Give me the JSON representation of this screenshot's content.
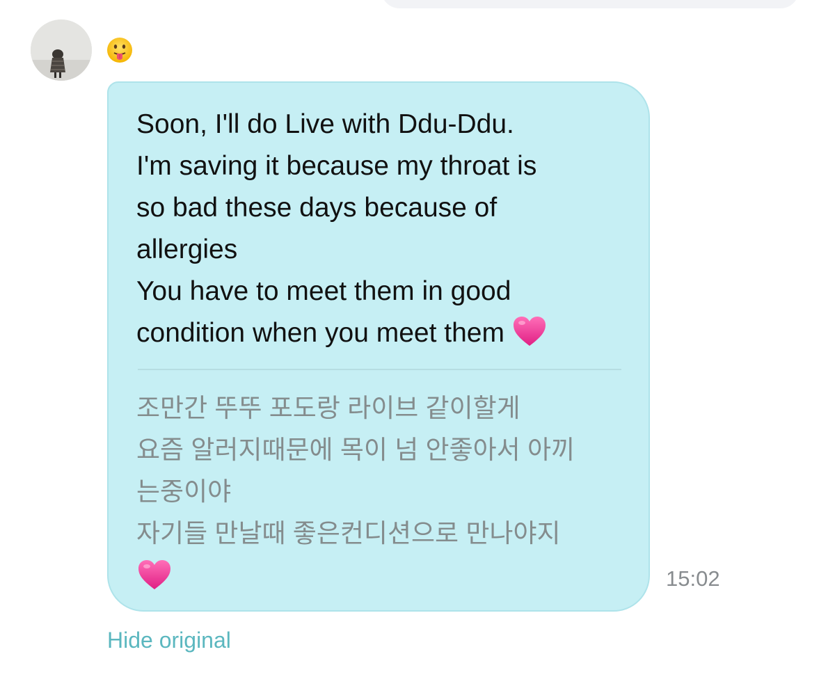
{
  "reaction": {
    "emoji_icon": "tongue-out-face-icon"
  },
  "message": {
    "translated_lines": [
      "Soon, I'll do Live with Ddu-Ddu.",
      "I'm saving it because my throat is",
      "so bad these days because of",
      "allergies",
      "You have to meet them in good",
      "condition when you meet them"
    ],
    "original_lines": [
      "조만간 뚜뚜 포도랑 라이브 같이할게",
      "요즘 알러지때문에 목이 넘 안좋아서 아끼",
      "는중이야",
      "자기들 만날때 좋은컨디션으로 만나야지"
    ],
    "heart_icon": "pink-heart-icon",
    "timestamp": "15:02"
  },
  "actions": {
    "hide_original_label": "Hide original"
  },
  "colors": {
    "bubble_bg": "#c6eff4",
    "accent_link": "#5bb7bf",
    "heart": "#f0389a"
  }
}
